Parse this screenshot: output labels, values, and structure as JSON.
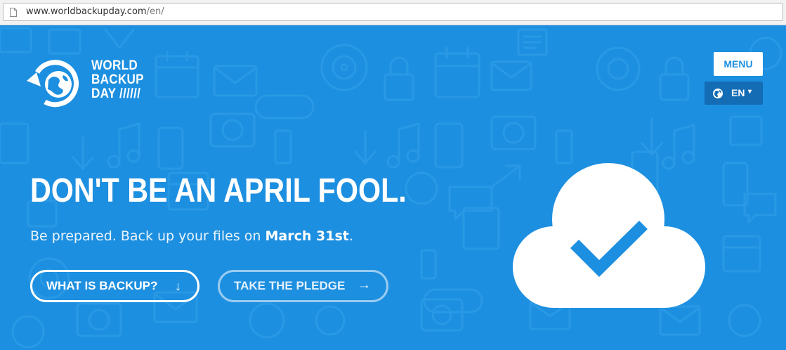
{
  "browser": {
    "url_host": "www.worldbackupday.com",
    "url_path": "/en/"
  },
  "logo": {
    "line1": "WORLD",
    "line2": "BACKUP",
    "line3": "DAY //////"
  },
  "nav": {
    "menu_label": "MENU",
    "language_label": "EN",
    "language_caret": "▾"
  },
  "hero": {
    "headline": "DON'T BE AN APRIL FOOL.",
    "subline_prefix": "Be prepared. Back up your files on ",
    "subline_date": "March 31st",
    "subline_suffix": ".",
    "buttons": [
      {
        "label": "WHAT IS BACKUP?",
        "arrow": "↓"
      },
      {
        "label": "TAKE THE PLEDGE",
        "arrow": "→"
      }
    ]
  },
  "icons": {
    "logo": "rotating-globe-backup-icon",
    "globe": "globe-icon",
    "cloud": "cloud-checkmark-icon",
    "page": "page-icon"
  },
  "colors": {
    "hero_background": "#1d8fe0",
    "language_button": "#136cb4",
    "text_white": "#ffffff"
  }
}
